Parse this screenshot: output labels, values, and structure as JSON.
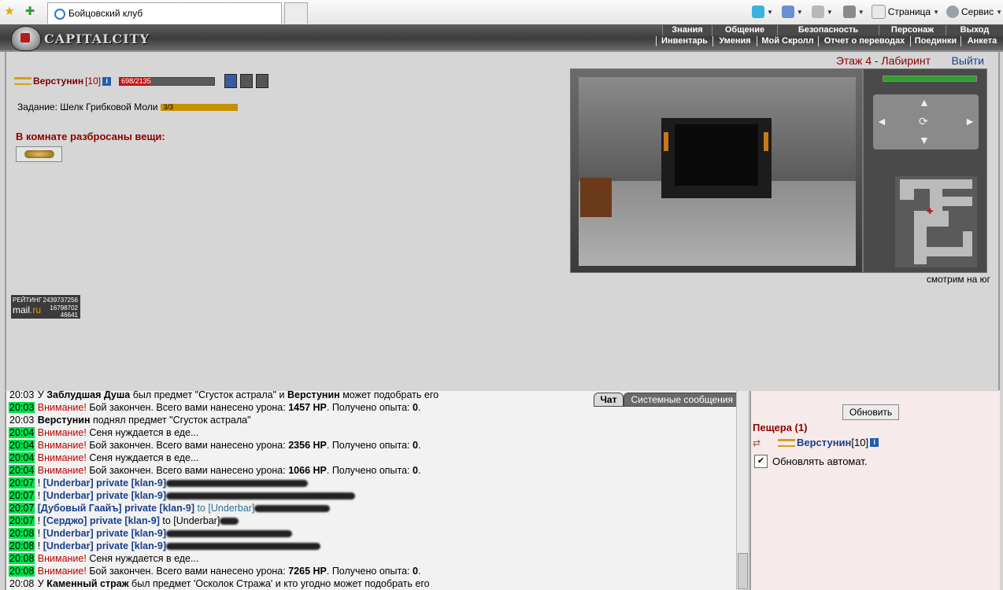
{
  "browser": {
    "tab_title": "Бойцовский клуб",
    "page_label": "Страница",
    "service_label": "Сервис"
  },
  "header": {
    "logo": "CAPITALCITY",
    "menu_top": [
      "Знания",
      "Общение",
      "Безопасность",
      "Персонаж",
      "Выход"
    ],
    "menu_bottom": [
      "Инвентарь",
      "Умения",
      "Мой Скролл",
      "Отчет о переводах",
      "Поединки",
      "Анкета"
    ]
  },
  "location": {
    "floor": "Этаж 4 - Лабиринт",
    "exit_label": "Выйти",
    "direction": "смотрим на юг"
  },
  "character": {
    "name": "Верстунин",
    "level": "[10]",
    "hp_text": "698/2135",
    "hp_current": 698,
    "hp_max": 2135
  },
  "task": {
    "label": "Задание: Шелк Грибковой Моли",
    "progress_text": "3/3",
    "progress": 1.0
  },
  "room_items": {
    "title": "В комнате разбросаны вещи:"
  },
  "counter": {
    "label": "РЕЙТИНГ",
    "v1": "2439737256",
    "v2": "16798702",
    "v3": "46641",
    "brand_mail": "mail",
    "brand_ru": ".ru"
  },
  "chat": {
    "tabs": [
      "Чат",
      "Системные сообщения"
    ],
    "lines": [
      {
        "t": "20:03",
        "hl": false,
        "parts": [
          {
            "c": "plain",
            "x": "У "
          },
          {
            "c": "b",
            "x": "Заблудшая Душа"
          },
          {
            "c": "plain",
            "x": " был предмет \"Сгусток астрала\" и "
          },
          {
            "c": "b",
            "x": "Верстунин"
          },
          {
            "c": "plain",
            "x": " может подобрать его"
          }
        ]
      },
      {
        "t": "20:03",
        "hl": true,
        "parts": [
          {
            "c": "warn",
            "x": "Внимание!"
          },
          {
            "c": "plain",
            "x": " Бой закончен. Всего вами нанесено урона: "
          },
          {
            "c": "b",
            "x": "1457 HP"
          },
          {
            "c": "plain",
            "x": ". Получено опыта: "
          },
          {
            "c": "b",
            "x": "0"
          },
          {
            "c": "plain",
            "x": "."
          }
        ]
      },
      {
        "t": "20:03",
        "hl": false,
        "parts": [
          {
            "c": "b",
            "x": "Верстунин"
          },
          {
            "c": "plain",
            "x": " поднял предмет \"Сгусток астрала\""
          }
        ]
      },
      {
        "t": "20:04",
        "hl": true,
        "parts": [
          {
            "c": "warn",
            "x": "Внимание!"
          },
          {
            "c": "plain",
            "x": " Сеня нуждается в еде..."
          }
        ]
      },
      {
        "t": "20:04",
        "hl": true,
        "parts": [
          {
            "c": "warn",
            "x": "Внимание!"
          },
          {
            "c": "plain",
            "x": " Бой закончен. Всего вами нанесено урона: "
          },
          {
            "c": "b",
            "x": "2356 HP"
          },
          {
            "c": "plain",
            "x": ". Получено опыта: "
          },
          {
            "c": "b",
            "x": "0"
          },
          {
            "c": "plain",
            "x": "."
          }
        ]
      },
      {
        "t": "20:04",
        "hl": true,
        "parts": [
          {
            "c": "warn",
            "x": "Внимание!"
          },
          {
            "c": "plain",
            "x": " Сеня нуждается в еде..."
          }
        ]
      },
      {
        "t": "20:04",
        "hl": true,
        "parts": [
          {
            "c": "warn",
            "x": "Внимание!"
          },
          {
            "c": "plain",
            "x": " Бой закончен. Всего вами нанесено урона: "
          },
          {
            "c": "b",
            "x": "1066 HP"
          },
          {
            "c": "plain",
            "x": ". Получено опыта: "
          },
          {
            "c": "b",
            "x": "0"
          },
          {
            "c": "plain",
            "x": "."
          }
        ]
      },
      {
        "t": "20:07",
        "hl": true,
        "parts": [
          {
            "c": "plain",
            "x": "! "
          },
          {
            "c": "nm",
            "x": "[Underbar]"
          },
          {
            "c": "plain",
            "x": " "
          },
          {
            "c": "pv",
            "x": "private [klan-9]"
          },
          {
            "c": "blur",
            "w": 180
          }
        ]
      },
      {
        "t": "20:07",
        "hl": true,
        "parts": [
          {
            "c": "plain",
            "x": "! "
          },
          {
            "c": "nm",
            "x": "[Underbar]"
          },
          {
            "c": "plain",
            "x": " "
          },
          {
            "c": "pv",
            "x": "private [klan-9]"
          },
          {
            "c": "blur",
            "w": 240
          }
        ]
      },
      {
        "t": "20:07",
        "hl": true,
        "parts": [
          {
            "c": "plain",
            "x": " "
          },
          {
            "c": "nm",
            "x": "[Дубовый Гаайъ]"
          },
          {
            "c": "plain",
            "x": " "
          },
          {
            "c": "pv",
            "x": "private [klan-9]"
          },
          {
            "c": "to",
            "x": " to [Underbar]"
          },
          {
            "c": "blur",
            "w": 96
          }
        ]
      },
      {
        "t": "20:07",
        "hl": true,
        "parts": [
          {
            "c": "plain",
            "x": "! "
          },
          {
            "c": "nm",
            "x": "[Серджо]"
          },
          {
            "c": "plain",
            "x": " "
          },
          {
            "c": "pv",
            "x": "private [klan-9]"
          },
          {
            "c": "plain",
            "x": " to [Underbar]"
          },
          {
            "c": "blur",
            "w": 24
          }
        ]
      },
      {
        "t": "20:08",
        "hl": true,
        "parts": [
          {
            "c": "plain",
            "x": "! "
          },
          {
            "c": "nm",
            "x": "[Underbar]"
          },
          {
            "c": "plain",
            "x": " "
          },
          {
            "c": "pv",
            "x": "private [klan-9]"
          },
          {
            "c": "blur",
            "w": 160
          }
        ]
      },
      {
        "t": "20:08",
        "hl": true,
        "parts": [
          {
            "c": "plain",
            "x": "! "
          },
          {
            "c": "nm",
            "x": "[Underbar]"
          },
          {
            "c": "plain",
            "x": " "
          },
          {
            "c": "pv",
            "x": "private [klan-9]"
          },
          {
            "c": "blur",
            "w": 196
          }
        ]
      },
      {
        "t": "20:08",
        "hl": true,
        "parts": [
          {
            "c": "warn",
            "x": "Внимание!"
          },
          {
            "c": "plain",
            "x": " Сеня нуждается в еде..."
          }
        ]
      },
      {
        "t": "20:08",
        "hl": true,
        "parts": [
          {
            "c": "warn",
            "x": "Внимание!"
          },
          {
            "c": "plain",
            "x": " Бой закончен. Всего вами нанесено урона: "
          },
          {
            "c": "b",
            "x": "7265 HP"
          },
          {
            "c": "plain",
            "x": ". Получено опыта: "
          },
          {
            "c": "b",
            "x": "0"
          },
          {
            "c": "plain",
            "x": "."
          }
        ]
      },
      {
        "t": "20:08",
        "hl": false,
        "parts": [
          {
            "c": "plain",
            "x": "У "
          },
          {
            "c": "b",
            "x": "Каменный страж"
          },
          {
            "c": "plain",
            "x": " был предмет 'Осколок Стража' и кто угодно может подобрать его"
          }
        ]
      }
    ]
  },
  "right_panel": {
    "refresh_label": "Обновить",
    "room_title": "Пещера (1)",
    "occupant_name": "Верстунин",
    "occupant_level": "[10]",
    "auto_refresh_label": "Обновлять автомат.",
    "auto_refresh_checked": true
  },
  "colors": {
    "accent_dark_red": "#8b0000",
    "link_blue": "#1a3f8c",
    "timestamp_green": "#00e04a",
    "warning_red": "#c00000"
  }
}
